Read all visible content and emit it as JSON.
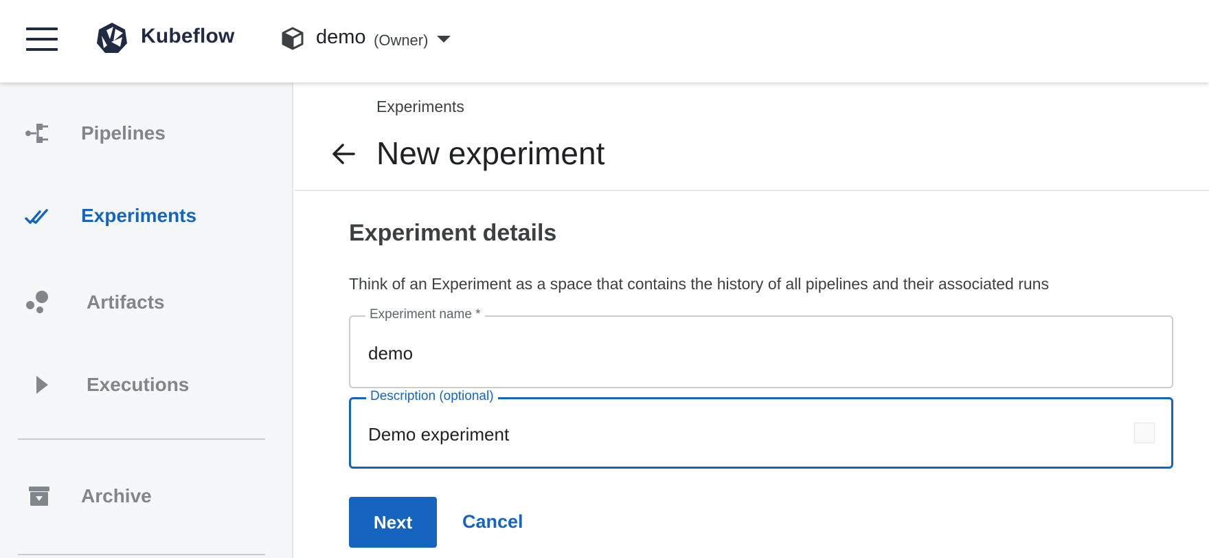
{
  "topbar": {
    "brand": "Kubeflow",
    "namespace": {
      "name": "demo",
      "role": "(Owner)"
    },
    "icons": {
      "menu": "hamburger-menu-icon",
      "logo": "kubeflow-logo-icon",
      "namespace": "cube-icon",
      "dropdown": "caret-down-icon"
    }
  },
  "sidebar": {
    "items": [
      {
        "label": "Pipelines",
        "icon": "pipelines-icon",
        "active": false
      },
      {
        "label": "Experiments",
        "icon": "experiments-icon",
        "active": true
      },
      {
        "label": "Artifacts",
        "icon": "artifacts-icon",
        "active": false
      },
      {
        "label": "Executions",
        "icon": "play-icon",
        "active": false
      },
      {
        "label": "Archive",
        "icon": "archive-icon",
        "active": false
      }
    ]
  },
  "main": {
    "breadcrumb": "Experiments",
    "title": "New experiment",
    "section_title": "Experiment details",
    "section_description": "Think of an Experiment as a space that contains the history of all pipelines and their associated runs",
    "fields": {
      "name": {
        "label": "Experiment name *",
        "value": "demo"
      },
      "description": {
        "label": "Description (optional)",
        "value": "Demo experiment"
      }
    },
    "buttons": {
      "next": "Next",
      "cancel": "Cancel"
    }
  },
  "colors": {
    "accent": "#1565c0",
    "sidebar_bg": "#f6f7f8",
    "nav_inactive": "#80868b",
    "brand_text": "#1f2a44"
  }
}
